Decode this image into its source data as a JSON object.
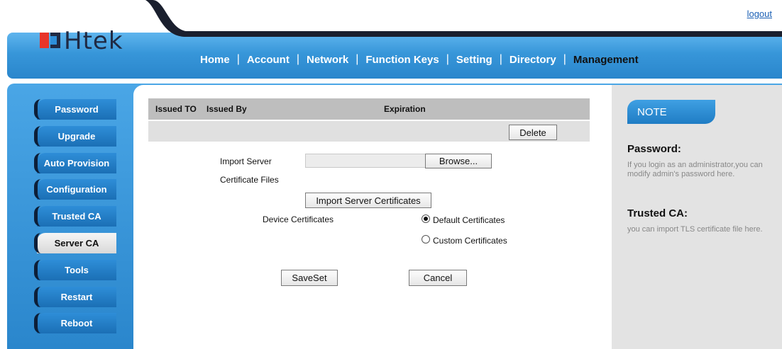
{
  "header": {
    "logout": "logout",
    "logo_text": "Htek",
    "nav": [
      "Home",
      "Account",
      "Network",
      "Function Keys",
      "Setting",
      "Directory",
      "Management"
    ],
    "active_nav": "Management"
  },
  "sidebar": {
    "items": [
      "Password",
      "Upgrade",
      "Auto Provision",
      "Configuration",
      "Trusted CA",
      "Server CA",
      "Tools",
      "Restart",
      "Reboot"
    ],
    "active": "Server CA"
  },
  "cert_table": {
    "columns": [
      "Issued TO",
      "Issued By",
      "Expiration"
    ],
    "delete_label": "Delete"
  },
  "form": {
    "import_label_line1": "Import Server",
    "import_label_line2": "Certificate Files",
    "file_value": "",
    "browse_label": "Browse...",
    "import_button": "Import Server Certificates",
    "device_cert_label": "Device Certificates",
    "radio_default": "Default Certificates",
    "radio_custom": "Custom Certificates",
    "selected": "Default Certificates",
    "save_label": "SaveSet",
    "cancel_label": "Cancel"
  },
  "note": {
    "title": "NOTE",
    "sections": [
      {
        "title": "Password:",
        "text": "If you login as an administrator,you can modify admin's password here."
      },
      {
        "title": "Trusted CA:",
        "text": "you can import TLS certificate file here."
      }
    ]
  },
  "colors": {
    "header_blue": "#3796d9",
    "sidebar_blue": "#1b6fb5",
    "note_bg": "#e3e3e3"
  }
}
